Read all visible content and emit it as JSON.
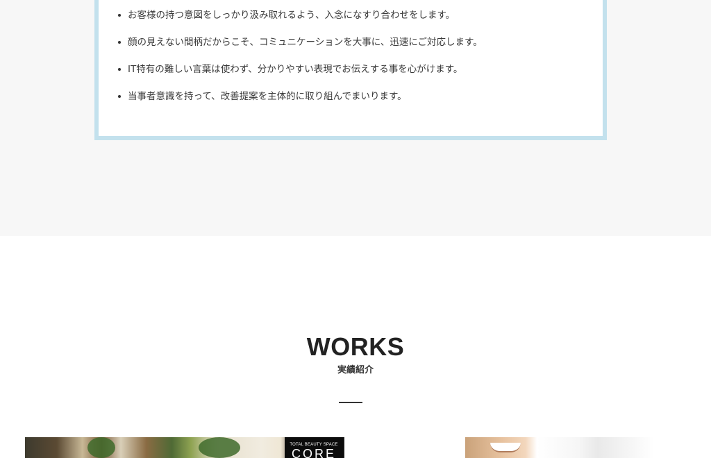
{
  "policy": {
    "items": [
      "お客様の持つ意図をしっかり汲み取れるよう、入念になすり合わせをします。",
      "顔の見えない間柄だからこそ、コミュニケーションを大事に、迅速にご対応します。",
      "IT特有の難しい言葉は使わず、分かりやすい表現でお伝えする事を心がけます。",
      "当事者意識を持って、改善提案を主体的に取り組んでまいります。"
    ]
  },
  "works": {
    "title": "WORKS",
    "subtitle": "実績紹介",
    "thumbnails": [
      {
        "logo_tagline": "TOTAL BEAUTY SPACE",
        "logo_brand": "CORE"
      }
    ]
  },
  "colors": {
    "top_background": "#f7f7f7",
    "box_border": "#c3e1ed",
    "title_text": "#222222"
  }
}
